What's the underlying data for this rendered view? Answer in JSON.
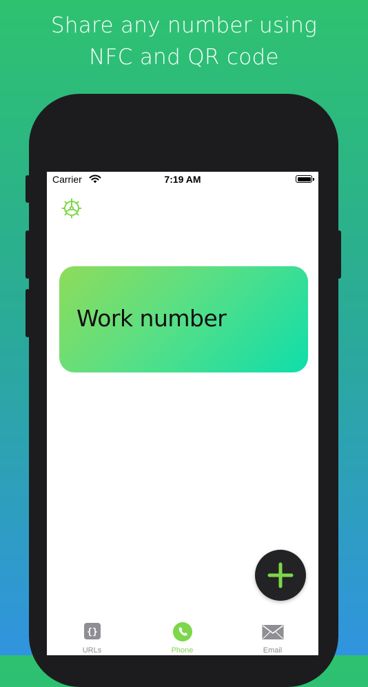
{
  "promo": {
    "line1": "Share any number using",
    "line2": "NFC and QR code"
  },
  "status_bar": {
    "carrier": "Carrier",
    "time": "7:19 AM",
    "wifi_icon": "wifi-icon",
    "battery_icon": "battery-icon"
  },
  "header": {
    "settings_icon": "gear-icon"
  },
  "cards": [
    {
      "title": "Work number"
    }
  ],
  "fab": {
    "icon": "plus-icon",
    "icon_color": "#7dd74a"
  },
  "tabs": [
    {
      "label": "URLs",
      "icon": "code-braces-icon",
      "selected": false
    },
    {
      "label": "Phone",
      "icon": "phone-icon",
      "selected": true
    },
    {
      "label": "Email",
      "icon": "envelope-icon",
      "selected": false
    }
  ],
  "colors": {
    "accent": "#7dd74a",
    "inactive": "#8e8e93",
    "card_gradient_start": "#8edc5a",
    "card_gradient_end": "#0fdeab"
  }
}
